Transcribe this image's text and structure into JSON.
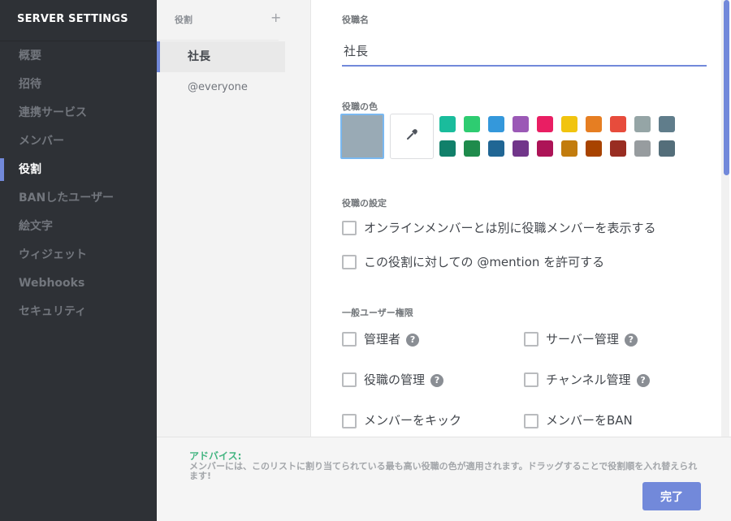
{
  "sidebar": {
    "title": "SERVER SETTINGS",
    "items": [
      {
        "label": "概要"
      },
      {
        "label": "招待"
      },
      {
        "label": "連携サービス"
      },
      {
        "label": "メンバー"
      },
      {
        "label": "役割"
      },
      {
        "label": "BANしたユーザー"
      },
      {
        "label": "絵文字"
      },
      {
        "label": "ウィジェット"
      },
      {
        "label": "Webhooks"
      },
      {
        "label": "セキュリティ"
      }
    ],
    "active_index": 4
  },
  "roles": {
    "header": "役割",
    "add_icon": "+",
    "items": [
      {
        "label": "社長"
      },
      {
        "label": "@everyone"
      }
    ]
  },
  "editor": {
    "name_label": "役職名",
    "name_value": "社長",
    "color_label": "役職の色",
    "selected_color": "#99aab5",
    "picker_icon": "eyedropper-icon",
    "palette_row1": [
      "#1abc9c",
      "#2ecc71",
      "#3498db",
      "#9b59b6",
      "#e91e63",
      "#f1c40f",
      "#e67e22",
      "#e74c3c",
      "#95a5a6",
      "#607d8b"
    ],
    "palette_row2": [
      "#11806a",
      "#1f8b4c",
      "#206694",
      "#71368a",
      "#ad1457",
      "#c27c0e",
      "#a84300",
      "#992d22",
      "#979c9f",
      "#546e7a"
    ],
    "settings_label": "役職の設定",
    "settings": [
      {
        "label": "オンラインメンバーとは別に役職メンバーを表示する",
        "checked": false
      },
      {
        "label": "この役割に対しての @mention を許可する",
        "checked": false
      }
    ],
    "perms_label": "一般ユーザー権限",
    "perms": [
      {
        "label": "管理者",
        "help": "?"
      },
      {
        "label": "サーバー管理",
        "help": "?"
      },
      {
        "label": "役職の管理",
        "help": "?"
      },
      {
        "label": "チャンネル管理",
        "help": "?"
      },
      {
        "label": "メンバーをキック"
      },
      {
        "label": "メンバーをBAN"
      }
    ]
  },
  "footer": {
    "tip_title": "アドバイス:",
    "tip_text": "メンバーには、このリストに割り当てられている最も高い役職の色が適用されます。ドラッグすることで役割順を入れ替えられます!",
    "done_label": "完了"
  }
}
